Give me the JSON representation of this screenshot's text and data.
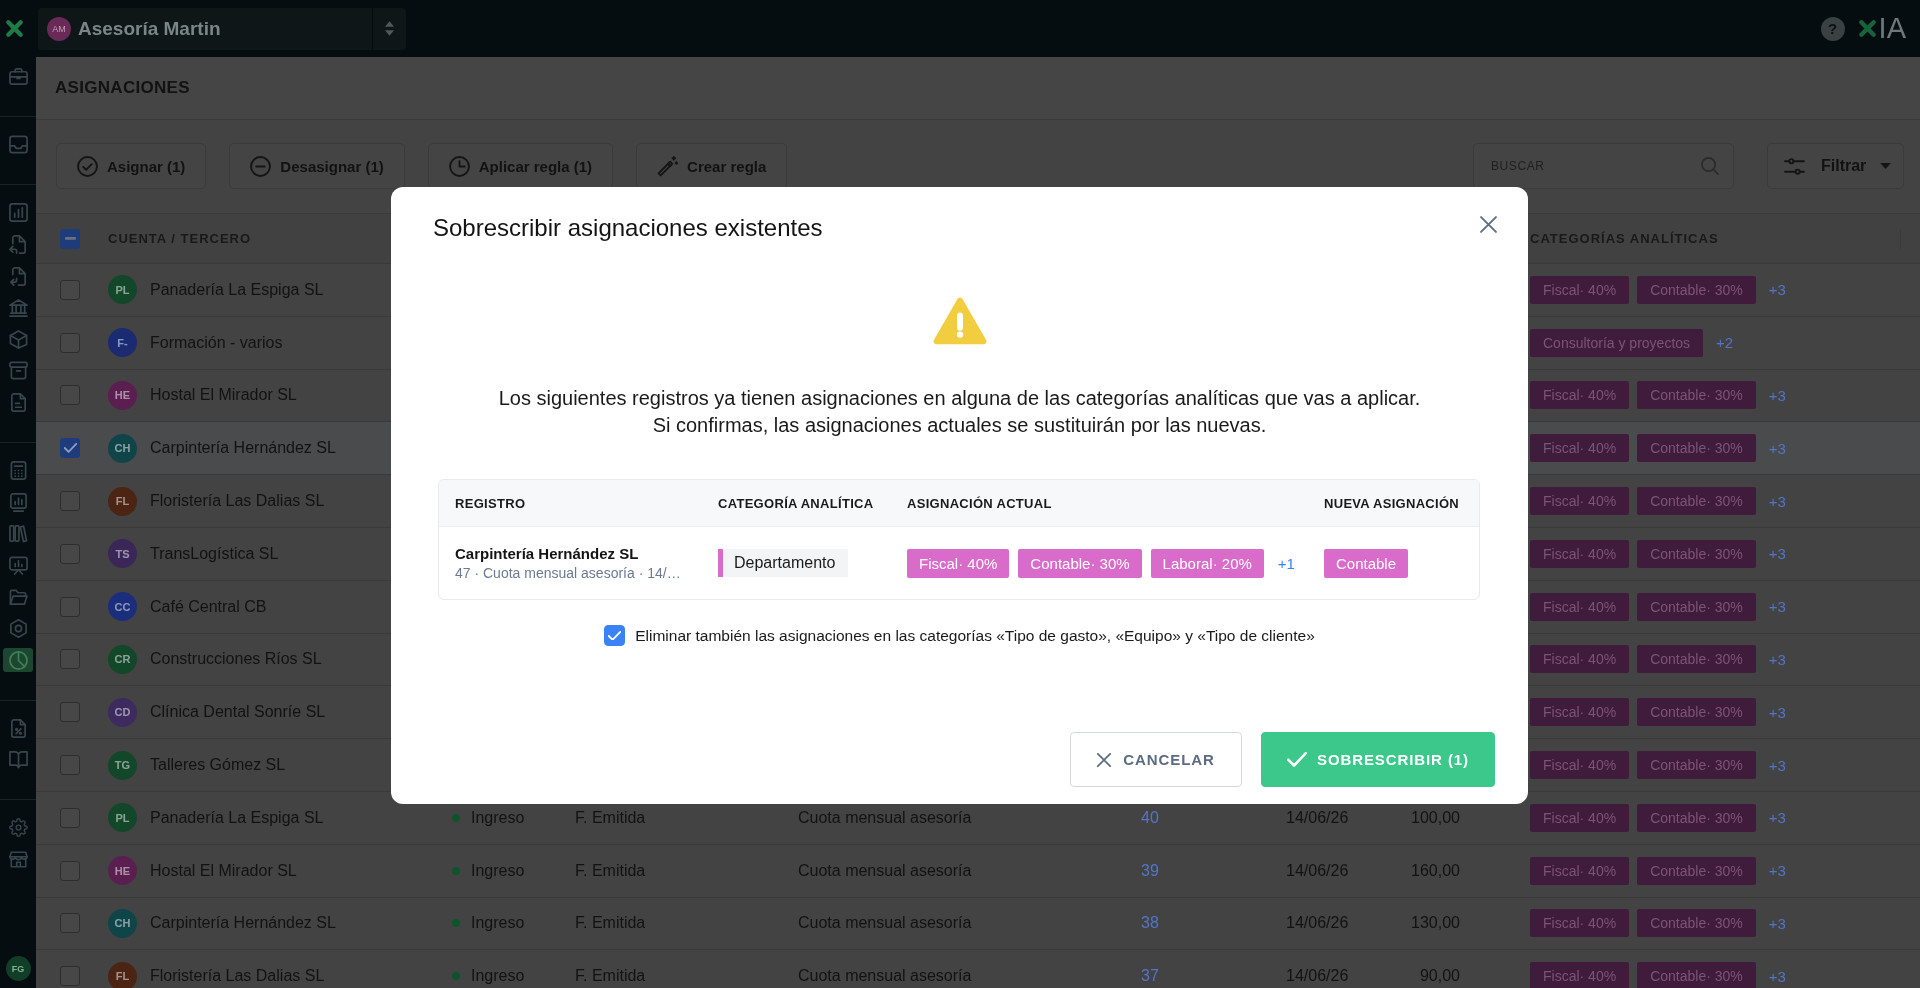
{
  "topbar": {
    "workspace": {
      "initials": "AM",
      "name": "Asesoría Martin"
    },
    "help": "?",
    "brand": "IA"
  },
  "sidebar": {
    "groups": [
      {
        "items": [
          {
            "selected": false
          }
        ]
      },
      {
        "items": [
          {
            "selected": false
          }
        ]
      },
      {
        "items": [
          {
            "selected": false
          },
          {
            "selected": false
          },
          {
            "selected": false
          },
          {
            "selected": false
          },
          {
            "selected": false
          },
          {
            "selected": false
          },
          {
            "selected": false
          }
        ]
      },
      {
        "items": [
          {
            "selected": false
          },
          {
            "selected": false
          },
          {
            "selected": false
          },
          {
            "selected": false
          },
          {
            "selected": false
          },
          {
            "selected": false
          },
          {
            "selected": true
          }
        ]
      },
      {
        "items": [
          {
            "selected": false
          },
          {
            "selected": false
          }
        ]
      },
      {
        "items": [
          {
            "selected": false
          },
          {
            "selected": false
          }
        ]
      }
    ],
    "user": {
      "initials": "FG"
    }
  },
  "page": {
    "title": "ASIGNACIONES"
  },
  "toolbar": {
    "buttons": [
      "Asignar (1)",
      "Desasignar (1)",
      "Aplicar regla (1)",
      "Crear regla"
    ],
    "search": {
      "placeholder": "BUSCAR"
    },
    "filter": "Filtrar"
  },
  "table": {
    "select_all": {
      "indeterminate": true
    },
    "columns": {
      "account": "CUENTA / TERCERO",
      "categories": "CATEGORÍAS ANALÍTICAS"
    },
    "rows": [
      {
        "initials": "PL",
        "color": "#13472a",
        "name": "Panadería La Espiga SL",
        "checked": false,
        "tags": [
          "Fiscal· 40%",
          "Contable· 30%"
        ],
        "more": "+3"
      },
      {
        "initials": "F-",
        "color": "#1b2b72",
        "name": "Formación - varios",
        "checked": false,
        "tags": [
          "Consultoría y proyectos"
        ],
        "more": "+2"
      },
      {
        "initials": "HE",
        "color": "#5a1f50",
        "name": "Hostal El Mirador SL",
        "checked": false,
        "tags": [
          "Fiscal· 40%",
          "Contable· 30%"
        ],
        "more": "+3"
      },
      {
        "initials": "CH",
        "color": "#0f4549",
        "name": "Carpintería Hernández SL",
        "checked": true,
        "tags": [
          "Fiscal· 40%",
          "Contable· 30%"
        ],
        "more": "+3"
      },
      {
        "initials": "FL",
        "color": "#4b2414",
        "name": "Floristería Las Dalias SL",
        "checked": false,
        "tags": [
          "Fiscal· 40%",
          "Contable· 30%"
        ],
        "more": "+3"
      },
      {
        "initials": "TS",
        "color": "#3b2757",
        "name": "TransLogística SL",
        "checked": false,
        "tags": [
          "Fiscal· 40%",
          "Contable· 30%"
        ],
        "more": "+3"
      },
      {
        "initials": "CC",
        "color": "#1b2e7c",
        "name": "Café Central CB",
        "checked": false,
        "tags": [
          "Fiscal· 40%",
          "Contable· 30%"
        ],
        "more": "+3"
      },
      {
        "initials": "CR",
        "color": "#13472a",
        "name": "Construcciones Ríos SL",
        "checked": false,
        "tags": [
          "Fiscal· 40%",
          "Contable· 30%"
        ],
        "more": "+3"
      },
      {
        "initials": "CD",
        "color": "#3d2a5e",
        "name": "Clínica Dental Sonríe SL",
        "checked": false,
        "tags": [
          "Fiscal· 40%",
          "Contable· 30%"
        ],
        "more": "+3"
      },
      {
        "initials": "TG",
        "color": "#13472a",
        "name": "Talleres Gómez SL",
        "checked": false,
        "tags": [
          "Fiscal· 40%",
          "Contable· 30%"
        ],
        "more": "+3"
      },
      {
        "initials": "PL",
        "color": "#13472a",
        "name": "Panadería La Espiga SL",
        "checked": false,
        "cells": [
          "Ingreso",
          "F. Emitida",
          "Cuota mensual asesoría",
          "40",
          "14/06/26",
          "100,00"
        ],
        "tags": [
          "Fiscal· 40%",
          "Contable· 30%"
        ],
        "more": "+3"
      },
      {
        "initials": "HE",
        "color": "#5a1f50",
        "name": "Hostal El Mirador SL",
        "checked": false,
        "cells": [
          "Ingreso",
          "F. Emitida",
          "Cuota mensual asesoría",
          "39",
          "14/06/26",
          "160,00"
        ],
        "tags": [
          "Fiscal· 40%",
          "Contable· 30%"
        ],
        "more": "+3"
      },
      {
        "initials": "CH",
        "color": "#0f4549",
        "name": "Carpintería Hernández SL",
        "checked": false,
        "cells": [
          "Ingreso",
          "F. Emitida",
          "Cuota mensual asesoría",
          "38",
          "14/06/26",
          "130,00"
        ],
        "tags": [
          "Fiscal· 40%",
          "Contable· 30%"
        ],
        "more": "+3"
      },
      {
        "initials": "FL",
        "color": "#4b2414",
        "name": "Floristería Las Dalias SL",
        "checked": false,
        "cells": [
          "Ingreso",
          "F. Emitida",
          "Cuota mensual asesoría",
          "37",
          "14/06/26",
          "90,00"
        ],
        "tags": [
          "Fiscal· 40%",
          "Contable· 30%"
        ],
        "more": "+3"
      }
    ]
  },
  "dialog": {
    "title": "Sobrescribir asignaciones existentes",
    "message": [
      "Los siguientes registros ya tienen asignaciones en alguna de las categorías analíticas que vas a aplicar.",
      "Si confirmas, las asignaciones actuales se sustituirán por las nuevas."
    ],
    "table": {
      "columns": [
        "REGISTRO",
        "CATEGORÍA ANALÍTICA",
        "ASIGNACIÓN ACTUAL",
        "NUEVA ASIGNACIÓN"
      ],
      "rows": [
        {
          "title": "Carpintería Hernández SL",
          "subtitle": "47 · Cuota mensual asesoría · 14/…",
          "category": "Departamento",
          "current": [
            "Fiscal· 40%",
            "Contable· 30%",
            "Laboral· 20%"
          ],
          "current_more": "+1",
          "new": [
            "Contable"
          ]
        }
      ]
    },
    "option": {
      "label": "Eliminar también las asignaciones en las categorías «Tipo de gasto», «Equipo» y «Tipo de cliente»",
      "checked": true
    },
    "actions": [
      {
        "label": "CANCELAR",
        "kind": "secondary"
      },
      {
        "label": "SOBRESCRIBIR (1)",
        "kind": "primary"
      }
    ]
  }
}
